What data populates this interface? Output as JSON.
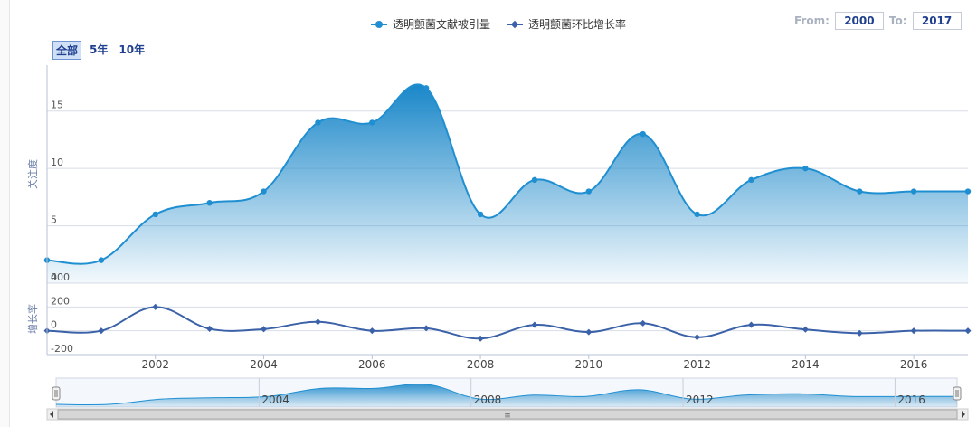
{
  "legend": [
    {
      "name": "透明颤菌文献被引量",
      "color": "#1f8fd1"
    },
    {
      "name": "透明颤菌环比增长率",
      "color": "#3b62a8"
    }
  ],
  "range_buttons": [
    "全部",
    "5年",
    "10年"
  ],
  "range_inputs": {
    "from_label": "From:",
    "from_value": "2000",
    "to_label": "To:",
    "to_value": "2017"
  },
  "chart_data": {
    "type": "line",
    "x": [
      2000,
      2001,
      2002,
      2003,
      2004,
      2005,
      2006,
      2007,
      2008,
      2009,
      2010,
      2011,
      2012,
      2013,
      2014,
      2015,
      2016,
      2017
    ],
    "x_ticks": [
      "2002",
      "2004",
      "2006",
      "2008",
      "2010",
      "2012",
      "2014",
      "2016"
    ],
    "panels": [
      {
        "ylabel": "关注度",
        "ylim": [
          0,
          19
        ],
        "y_ticks": [
          "0",
          "5",
          "10",
          "15"
        ],
        "series": [
          {
            "name": "透明颤菌文献被引量",
            "style": "area",
            "color": "#1f8fd1",
            "values": [
              2,
              2,
              6,
              7,
              8,
              14,
              14,
              17,
              6,
              9,
              8,
              13,
              6,
              9,
              10,
              8,
              8,
              8
            ]
          }
        ]
      },
      {
        "ylabel": "增长率",
        "ylim": [
          -200,
          400
        ],
        "y_ticks": [
          "-200",
          "0",
          "200",
          "400"
        ],
        "series": [
          {
            "name": "透明颤菌环比增长率",
            "style": "line",
            "color": "#3b62a8",
            "values": [
              0,
              0,
              200,
              17,
              14,
              75,
              0,
              21,
              -65,
              50,
              -11,
              63,
              -54,
              50,
              11,
              -20,
              0,
              0
            ]
          }
        ]
      }
    ],
    "navigator": {
      "x_ticks": [
        "2004",
        "2008",
        "2012",
        "2016"
      ],
      "scrollbar_grip": "≡"
    },
    "grid": true
  }
}
